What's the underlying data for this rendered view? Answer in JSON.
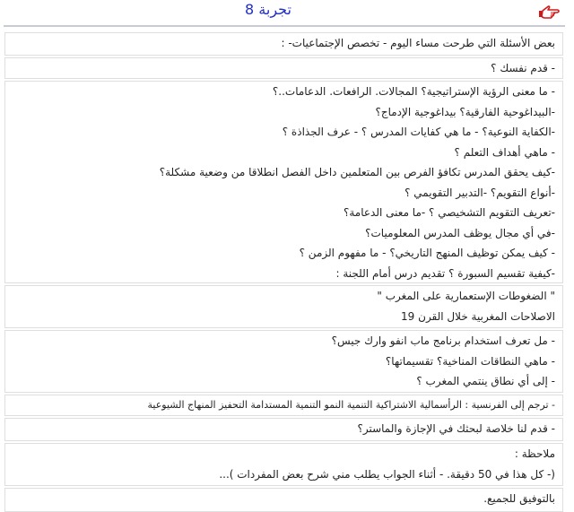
{
  "header": {
    "title": "تجربة 8",
    "icon": "pointing-hand-icon",
    "title_color": "#1f2fc2"
  },
  "blocks": [
    {
      "lines": [
        "بعض الأسئلة التي طرحت مساء اليوم -  تخصص الإجتماعيات- :"
      ]
    },
    {
      "lines": [
        "- قدم نفسك ؟"
      ]
    },
    {
      "lines": [
        "- ما معنى الرؤية الإستراتيجية؟ المجالات. الرافعات. الدعامات..؟",
        "-البيداغوحية الفارقية؟ بيداغوجية الإدماج؟",
        "-الكفاية النوعية؟ - ما هي كفايات المدرس ؟ - عرف الجذاذة ؟",
        "- ماهي أهداف التعلم ؟",
        "-كيف يحقق المدرس تكافؤ الفرص بين المتعلمين داخل الفصل انطلاقا من وضعية مشكلة؟",
        "-أنواع التقويم؟ -التدبير التقويمي ؟",
        "-تعريف التقويم التشخيصي ؟ -ما معنى الدعامة؟",
        "-في أي مجال يوظف المدرس المعلوميات؟",
        "- كيف يمكن توظيف المنهج التاريخي؟ - ما مفهوم الزمن ؟",
        "-كيفية تقسيم السبورة ؟ تقديم درس أمام اللجنة :"
      ]
    },
    {
      "lines": [
        "\" الضغوطات الإستعمارية على المغرب \"",
        "الاصلاحات المغربية خلال القرن 19"
      ]
    },
    {
      "lines": [
        "- مل تعرف استخدام برنامج ماب انفو وارك جيس؟",
        "- ماهي النطاقات المناخية؟ تقسيماتها؟",
        "- إلى أي نطاق ينتمي المغرب ؟"
      ]
    },
    {
      "lines": [
        "- ترجم إلى الفرنسية : الرأسمالية الاشتراكية التنمية النمو التنمية المستدامة التحفيز المنهاج الشيوعية"
      ]
    },
    {
      "lines": [
        "- قدم لنا خلاصة لبحثك في الإجازة والماستر؟"
      ]
    },
    {
      "lines": [
        "ملاحظة :",
        "(- كل هذا في 50 دقيقة. - أثناء الجواب يطلب مني شرح بعض المفردات )..."
      ]
    },
    {
      "lines": [
        "بالتوفيق للجميع."
      ]
    }
  ]
}
